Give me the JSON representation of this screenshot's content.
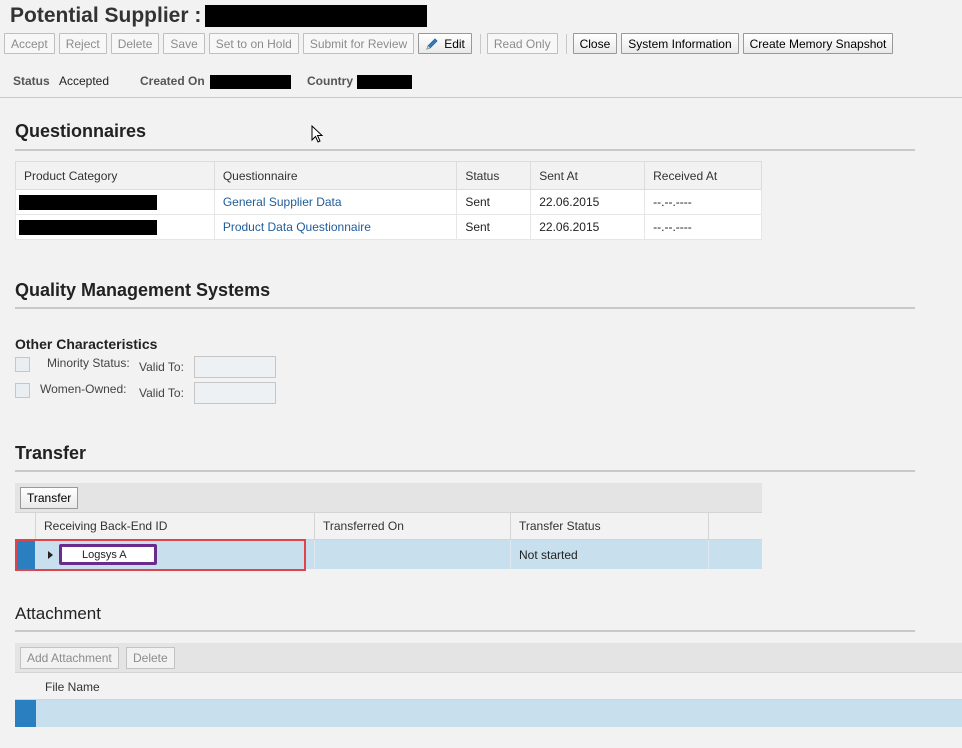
{
  "header": {
    "title": "Potential Supplier :",
    "toolbar": {
      "accept": "Accept",
      "reject": "Reject",
      "delete": "Delete",
      "save": "Save",
      "set_on_hold": "Set to on Hold",
      "submit_review": "Submit for Review",
      "edit": "Edit",
      "read_only": "Read Only",
      "close": "Close",
      "system_information": "System Information",
      "memory_snapshot": "Create Memory Snapshot"
    }
  },
  "status_bar": {
    "status_label": "Status",
    "status_value": "Accepted",
    "created_on_label": "Created On",
    "country_label": "Country"
  },
  "questionnaires": {
    "title": "Questionnaires",
    "columns": [
      "Product Category",
      "Questionnaire",
      "Status",
      "Sent At",
      "Received At"
    ],
    "rows": [
      {
        "questionnaire": "General Supplier Data",
        "status": "Sent",
        "sent_at": "22.06.2015",
        "received_at": "--.--.----"
      },
      {
        "questionnaire": "Product Data Questionnaire",
        "status": "Sent",
        "sent_at": "22.06.2015",
        "received_at": "--.--.----"
      }
    ]
  },
  "qms": {
    "title": "Quality Management Systems"
  },
  "other_characteristics": {
    "title": "Other Characteristics",
    "minority_label": "Minority Status:",
    "women_owned_label": "Women-Owned:",
    "valid_to_label": "Valid To:"
  },
  "transfer": {
    "title": "Transfer",
    "button": "Transfer",
    "columns": [
      "Receiving Back-End ID",
      "Transferred On",
      "Transfer Status"
    ],
    "row": {
      "backend_id": "Logsys A",
      "transferred_on": "",
      "status": "Not started"
    }
  },
  "attachment": {
    "title": "Attachment",
    "add_button": "Add Attachment",
    "delete_button": "Delete",
    "column_file_name": "File Name"
  },
  "colors": {
    "selection_blue": "#2a7fc1",
    "row_highlight": "#c8dfee",
    "link": "#1f5c99",
    "annotation_red": "#e0444a",
    "annotation_purple": "#6a2b8c"
  }
}
